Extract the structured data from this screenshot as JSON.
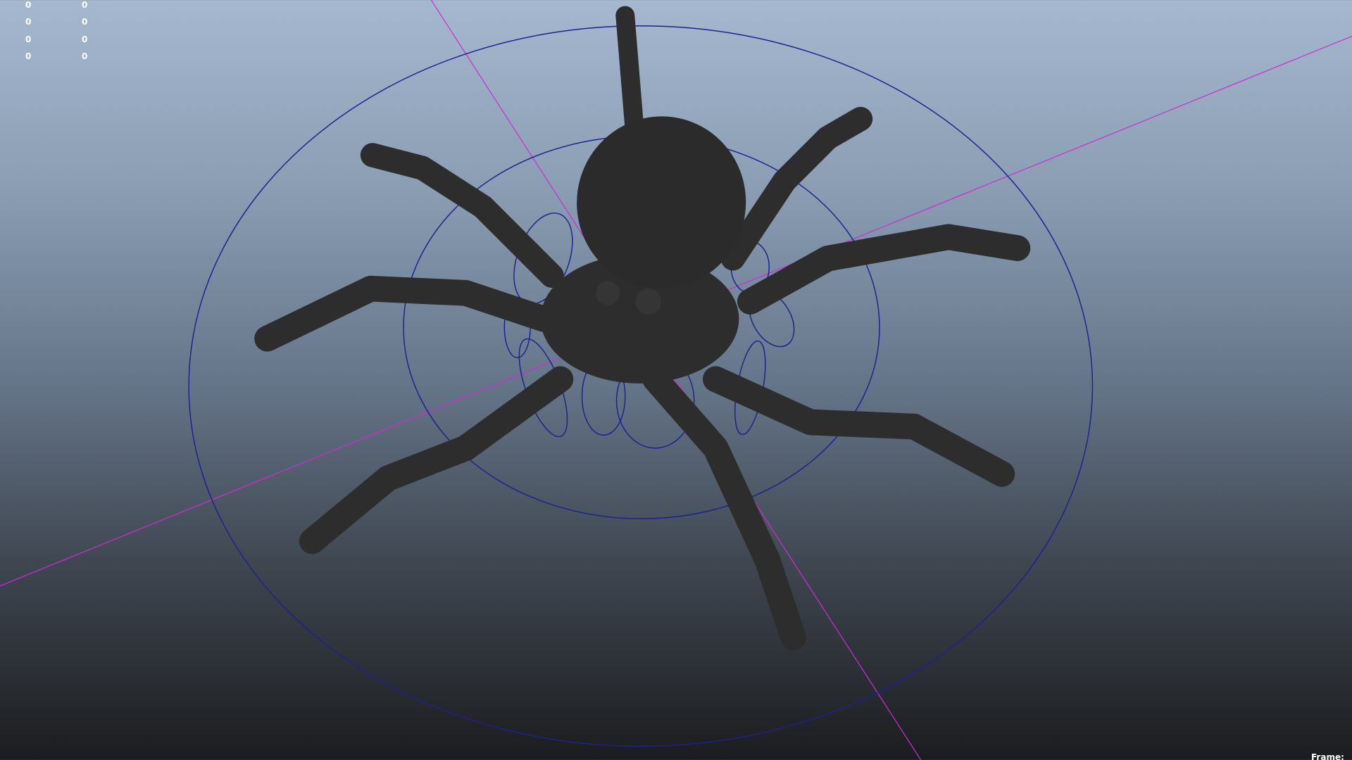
{
  "hud": {
    "col1": [
      "0",
      "0",
      "0",
      "0"
    ],
    "col2": [
      "0",
      "0",
      "0",
      "0"
    ]
  },
  "frame_label": "Frame:",
  "colors": {
    "axis": "#d02ad8",
    "wire": "#1a1f8a",
    "mesh": "#2d2d2d"
  }
}
